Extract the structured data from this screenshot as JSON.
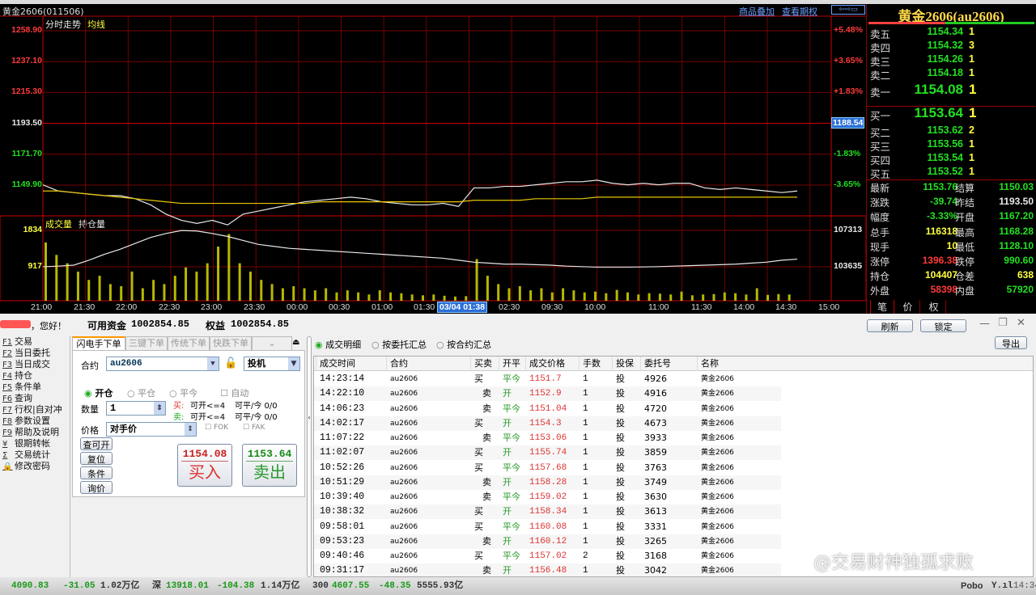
{
  "window": {
    "title": "黄金2606(011506)",
    "links": [
      "商品叠加",
      "查看期权"
    ]
  },
  "chart_labels": {
    "mode": "分时走势",
    "avg": "均线",
    "vol": "成交量",
    "oi": "持仓量",
    "cursor_time": "03/04 01:38",
    "cursor_price": "1188.54"
  },
  "chart_data": {
    "type": "line",
    "title": "分时走势",
    "price_ticks": [
      "1258.90",
      "1237.10",
      "1215.30",
      "1193.50",
      "1171.70",
      "1149.90"
    ],
    "pct_ticks": [
      "+5.48%",
      "+3.65%",
      "+1.83%",
      "-1.83%",
      "-3.65%"
    ],
    "ylim": [
      1138.9,
      1258.9
    ],
    "prev_settle": 1193.5,
    "x_ticks": [
      "21:00",
      "21:30",
      "22:00",
      "22:30",
      "23:00",
      "23:30",
      "00:00",
      "00:30",
      "01:00",
      "01:30",
      "02:30",
      "09:30",
      "10:00",
      "11:00",
      "11:30",
      "14:00",
      "14:30",
      "15:00"
    ],
    "price_series": [
      1159,
      1155,
      1154,
      1153,
      1152,
      1152,
      1150,
      1146,
      1140,
      1136,
      1134,
      1136,
      1133,
      1140,
      1142,
      1144,
      1146,
      1148,
      1149,
      1150,
      1151,
      1150,
      1148,
      1147,
      1146,
      1146,
      1147,
      1145,
      1157,
      1157,
      1158,
      1158,
      1159,
      1160,
      1161,
      1161,
      1162,
      1160,
      1159,
      1160,
      1159,
      1160,
      1160,
      1157,
      1156,
      1157,
      1156,
      1155,
      1154,
      1155
    ],
    "avg_series": [
      1155,
      1155,
      1154,
      1153,
      1152,
      1151,
      1150,
      1149,
      1148,
      1147,
      1147,
      1147,
      1147,
      1147,
      1147,
      1147,
      1147,
      1147,
      1148,
      1148,
      1148,
      1148,
      1148,
      1148,
      1148,
      1148,
      1148,
      1148,
      1149,
      1149,
      1149,
      1149,
      1150,
      1150,
      1150,
      1150,
      1151,
      1151,
      1151,
      1151,
      1151,
      1151,
      1151,
      1151,
      1151,
      1151,
      1151,
      1151,
      1151,
      1151
    ],
    "vol_ticks": [
      "1834",
      "917"
    ],
    "oi_ticks": [
      "107313",
      "103635"
    ],
    "oi_series": [
      103640,
      103700,
      103800,
      104300,
      104900,
      105400,
      106000,
      106600,
      107000,
      107300,
      107250,
      107000,
      106700,
      106300,
      105900,
      105700,
      105500,
      105400,
      105300,
      105200,
      105100,
      105000,
      104900,
      104800,
      104700,
      104600,
      104500,
      104300,
      104100,
      104000,
      103900,
      103900,
      103850,
      103800,
      103700,
      103650,
      103600,
      103600,
      103600,
      103620,
      103650,
      103700,
      103750,
      103800,
      103850,
      103900,
      104000,
      104100,
      104300,
      104407
    ],
    "volume": [
      1400,
      1100,
      900,
      700,
      500,
      600,
      400,
      350,
      700,
      300,
      500,
      400,
      600,
      800,
      700,
      900,
      1300,
      1600,
      900,
      700,
      500,
      400,
      300,
      350,
      300,
      250,
      300,
      200,
      250,
      200,
      150,
      250,
      200,
      180,
      150,
      130,
      150,
      120,
      100,
      110,
      1000,
      600,
      400,
      300,
      350,
      250,
      300,
      200,
      300,
      250,
      200,
      220,
      180,
      260,
      200,
      150,
      180,
      170,
      150,
      220,
      130,
      150,
      160,
      200,
      180,
      150,
      300,
      140,
      160,
      150
    ]
  },
  "quote": {
    "name": "黄金2606(au2606)",
    "asks": [
      {
        "l": "卖五",
        "p": "1154.34",
        "v": "1"
      },
      {
        "l": "卖四",
        "p": "1154.32",
        "v": "3"
      },
      {
        "l": "卖三",
        "p": "1154.26",
        "v": "1"
      },
      {
        "l": "卖二",
        "p": "1154.18",
        "v": "1"
      },
      {
        "l": "卖一",
        "p": "1154.08",
        "v": "1"
      }
    ],
    "bids": [
      {
        "l": "买一",
        "p": "1153.64",
        "v": "1"
      },
      {
        "l": "买二",
        "p": "1153.62",
        "v": "2"
      },
      {
        "l": "买三",
        "p": "1153.56",
        "v": "1"
      },
      {
        "l": "买四",
        "p": "1153.54",
        "v": "1"
      },
      {
        "l": "买五",
        "p": "1153.52",
        "v": "1"
      }
    ],
    "stats": [
      {
        "l1": "最新",
        "v1": "1153.76",
        "c1": "#22e022",
        "l2": "结算",
        "v2": "1150.03",
        "c2": "#22e022"
      },
      {
        "l1": "涨跌",
        "v1": "-39.74",
        "c1": "#22e022",
        "l2": "昨结",
        "v2": "1193.50",
        "c2": "#e8e8e8"
      },
      {
        "l1": "幅度",
        "v1": "-3.33%",
        "c1": "#22e022",
        "l2": "开盘",
        "v2": "1167.20",
        "c2": "#22e022"
      },
      {
        "l1": "总手",
        "v1": "116318",
        "c1": "#ffff40",
        "l2": "最高",
        "v2": "1168.28",
        "c2": "#22e022"
      },
      {
        "l1": "现手",
        "v1": "10",
        "c1": "#ffff40",
        "l2": "最低",
        "v2": "1128.10",
        "c2": "#22e022"
      },
      {
        "l1": "涨停",
        "v1": "1396.38",
        "c1": "#ff3a3a",
        "l2": "跌停",
        "v2": "990.60",
        "c2": "#22e022"
      },
      {
        "l1": "持仓",
        "v1": "104407",
        "c1": "#ffff40",
        "l2": "仓差",
        "v2": "638",
        "c2": "#ffff40"
      },
      {
        "l1": "外盘",
        "v1": "58398",
        "c1": "#ff3a3a",
        "l2": "内盘",
        "v2": "57920",
        "c2": "#22e022"
      }
    ],
    "tabs": [
      "笔",
      "价",
      "权"
    ]
  },
  "account": {
    "greeting": "，您好！",
    "avail_label": "可用资金",
    "avail": "1002854.85",
    "equity_label": "权益",
    "equity": "1002854.85",
    "refresh": "刷新",
    "lock": "锁定",
    "export": "导出"
  },
  "menu": [
    {
      "k": "F1",
      "t": "交易"
    },
    {
      "k": "F2",
      "t": "当日委托"
    },
    {
      "k": "F3",
      "t": "当日成交"
    },
    {
      "k": "F4",
      "t": "持仓"
    },
    {
      "k": "F5",
      "t": "条件单"
    },
    {
      "k": "F6",
      "t": "查询"
    },
    {
      "k": "F7",
      "t": "行权|自对冲"
    },
    {
      "k": "F8",
      "t": "参数设置"
    },
    {
      "k": "F9",
      "t": "帮助及说明"
    },
    {
      "k": "¥",
      "t": "银期转帐"
    },
    {
      "k": "Σ",
      "t": "交易统计"
    },
    {
      "k": "🔒",
      "t": "修改密码"
    }
  ],
  "order": {
    "tabs": [
      "闪电手下单",
      "三键下单",
      "传统下单",
      "快跌下单"
    ],
    "contract_label": "合约",
    "contract": "au2606",
    "hedge": "投机",
    "open": "开仓",
    "close": "平仓",
    "close_today": "平今",
    "auto": "自动",
    "qty_label": "数量",
    "qty": "1",
    "buy_info": "买:",
    "sell_info": "卖:",
    "can_open": "可开<=4",
    "can_close": "可平/今 0/0",
    "price_label": "价格",
    "price": "对手价",
    "fok": "FOK",
    "fak": "FAK",
    "btns": [
      "查可开",
      "复位",
      "条件",
      "询价"
    ],
    "buy_price": "1154.08",
    "buy_label": "买入",
    "sell_price": "1153.64",
    "sell_label": "卖出"
  },
  "trades": {
    "views": [
      "成交明细",
      "按委托汇总",
      "按合约汇总"
    ],
    "headers": [
      "成交时间",
      "合约",
      "买卖",
      "开平",
      "成交价格",
      "手数",
      "投保",
      "委托号",
      "名称"
    ],
    "rows": [
      [
        "14:23:14",
        "au2606",
        "买",
        "平今",
        "1151.7",
        "1",
        "投",
        "4926",
        "黄金2606"
      ],
      [
        "14:22:10",
        "au2606",
        "卖",
        "开",
        "1152.9",
        "1",
        "投",
        "4916",
        "黄金2606"
      ],
      [
        "14:06:23",
        "au2606",
        "卖",
        "平今",
        "1151.04",
        "1",
        "投",
        "4720",
        "黄金2606"
      ],
      [
        "14:02:17",
        "au2606",
        "买",
        "开",
        "1154.3",
        "1",
        "投",
        "4673",
        "黄金2606"
      ],
      [
        "11:07:22",
        "au2606",
        "卖",
        "平今",
        "1153.06",
        "1",
        "投",
        "3933",
        "黄金2606"
      ],
      [
        "11:02:07",
        "au2606",
        "买",
        "开",
        "1155.74",
        "1",
        "投",
        "3859",
        "黄金2606"
      ],
      [
        "10:52:26",
        "au2606",
        "买",
        "平今",
        "1157.68",
        "1",
        "投",
        "3763",
        "黄金2606"
      ],
      [
        "10:51:29",
        "au2606",
        "卖",
        "开",
        "1158.28",
        "1",
        "投",
        "3749",
        "黄金2606"
      ],
      [
        "10:39:40",
        "au2606",
        "卖",
        "平今",
        "1159.02",
        "1",
        "投",
        "3630",
        "黄金2606"
      ],
      [
        "10:38:32",
        "au2606",
        "买",
        "开",
        "1158.34",
        "1",
        "投",
        "3613",
        "黄金2606"
      ],
      [
        "09:58:01",
        "au2606",
        "买",
        "平今",
        "1160.08",
        "1",
        "投",
        "3331",
        "黄金2606"
      ],
      [
        "09:53:23",
        "au2606",
        "卖",
        "开",
        "1160.12",
        "1",
        "投",
        "3265",
        "黄金2606"
      ],
      [
        "09:40:46",
        "au2606",
        "买",
        "平今",
        "1157.02",
        "2",
        "投",
        "3168",
        "黄金2606"
      ],
      [
        "09:31:17",
        "au2606",
        "卖",
        "开",
        "1156.48",
        "1",
        "投",
        "3042",
        "黄金2606"
      ]
    ]
  },
  "status": {
    "i1": "4090.83",
    "c1": "-31.05",
    "a1": "1.02万亿",
    "n2": "深",
    "i2": "13918.01",
    "c2": "-104.38",
    "a2": "1.14万亿",
    "n3": "300",
    "i3": "4607.55",
    "c3": "-48.35",
    "a3": "5555.93亿",
    "brand": "Pobo",
    "time": "14:34"
  },
  "watermark": "@交易财神独孤求败"
}
